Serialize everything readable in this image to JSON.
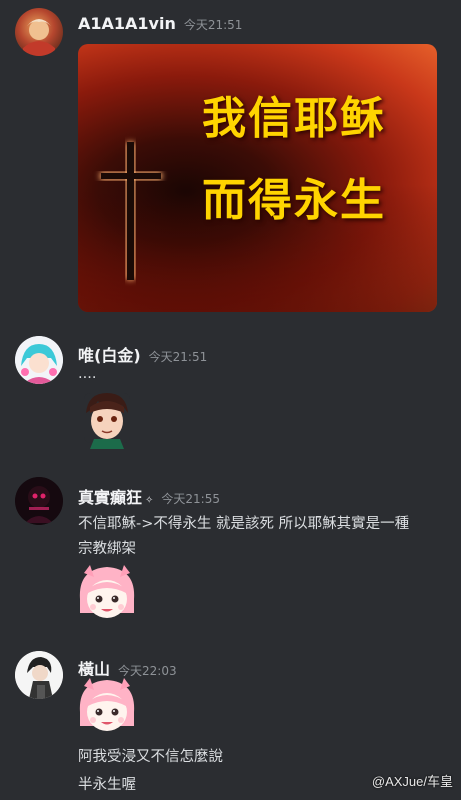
{
  "messages": [
    {
      "user": "A1A1A1vin",
      "time": "今天21:51",
      "image_caption": [
        "我信耶稣",
        "而得永生"
      ]
    },
    {
      "user": "唯(白金)",
      "time": "今天21:51",
      "text": "...."
    },
    {
      "user": "真實癲狂",
      "time": "今天21:55",
      "text_lines": [
        "不信耶穌->不得永生 就是該死 所以耶穌其實是一種",
        "宗教綁架"
      ]
    },
    {
      "user": "橫山",
      "time": "今天22:03",
      "text_lines": [
        "阿我受浸又不信怎麼說",
        "半永生喔"
      ]
    }
  ],
  "watermark": "@AXJue/车皇",
  "colors": {
    "background": "#2b2d31",
    "name": "#f2f3f5",
    "timestamp": "#8e9297",
    "image_text": "#ffd400"
  }
}
